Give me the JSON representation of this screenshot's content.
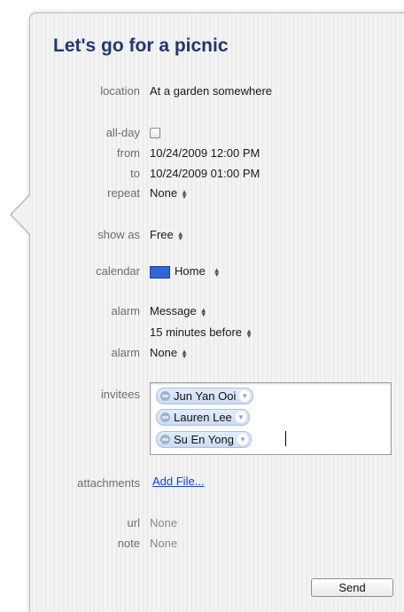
{
  "event": {
    "title": "Let's go for a picnic"
  },
  "fields": {
    "location": {
      "label": "location",
      "value": "At a garden somewhere"
    },
    "allday": {
      "label": "all-day",
      "checked": false
    },
    "from": {
      "label": "from",
      "value": "10/24/2009 12:00 PM"
    },
    "to": {
      "label": "to",
      "value": "10/24/2009 01:00 PM"
    },
    "repeat": {
      "label": "repeat",
      "value": "None"
    },
    "show_as": {
      "label": "show as",
      "value": "Free"
    },
    "calendar": {
      "label": "calendar",
      "value": "Home",
      "color": "#2f67d8"
    },
    "alarm1": {
      "label": "alarm",
      "type": "Message",
      "timing": "15 minutes before"
    },
    "alarm2": {
      "label": "alarm",
      "value": "None"
    },
    "invitees": {
      "label": "invitees",
      "people": [
        "Jun Yan Ooi",
        "Lauren Lee",
        "Su En Yong"
      ]
    },
    "attachments": {
      "label": "attachments",
      "link": "Add File..."
    },
    "url": {
      "label": "url",
      "value": "None"
    },
    "note": {
      "label": "note",
      "value": "None"
    }
  },
  "actions": {
    "send_label": "Send"
  },
  "icons": {
    "popup_arrows": "up-down-chevron-icon",
    "token_menu": "chevron-down-icon",
    "contact": "person-icon"
  },
  "colors": {
    "title": "#22376e",
    "link": "#1a3fd6",
    "label": "#6e6e6e"
  }
}
